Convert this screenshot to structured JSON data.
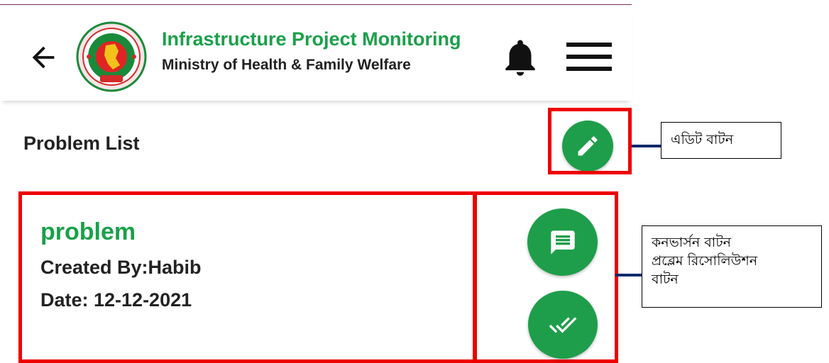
{
  "header": {
    "title": "Infrastructure Project Monitoring",
    "subtitle": "Ministry of Health & Family Welfare",
    "back_icon": "arrow-left-icon",
    "logo_icon": "government-seal-logo",
    "notification_icon": "bell-icon",
    "menu_icon": "hamburger-menu-icon"
  },
  "page": {
    "title": "Problem List",
    "edit_icon": "pencil-icon"
  },
  "problem_card": {
    "name": "problem",
    "created_by": "Created By:Habib",
    "date": "Date: 12-12-2021",
    "conversation_icon": "chat-icon",
    "resolve_icon": "double-check-icon"
  },
  "annotations": {
    "edit_label": "এডিট বাটন",
    "conversation_label": "কনভার্সন বাটন",
    "resolution_label_1": "প্রব্লেম রিসোলিউশন",
    "resolution_label_2": "বাটন"
  },
  "colors": {
    "brand_green": "#1aa04a",
    "fab_green": "#1e9e4a",
    "annotation_red": "#ee0000",
    "arrow_navy": "#0d2a6b"
  }
}
